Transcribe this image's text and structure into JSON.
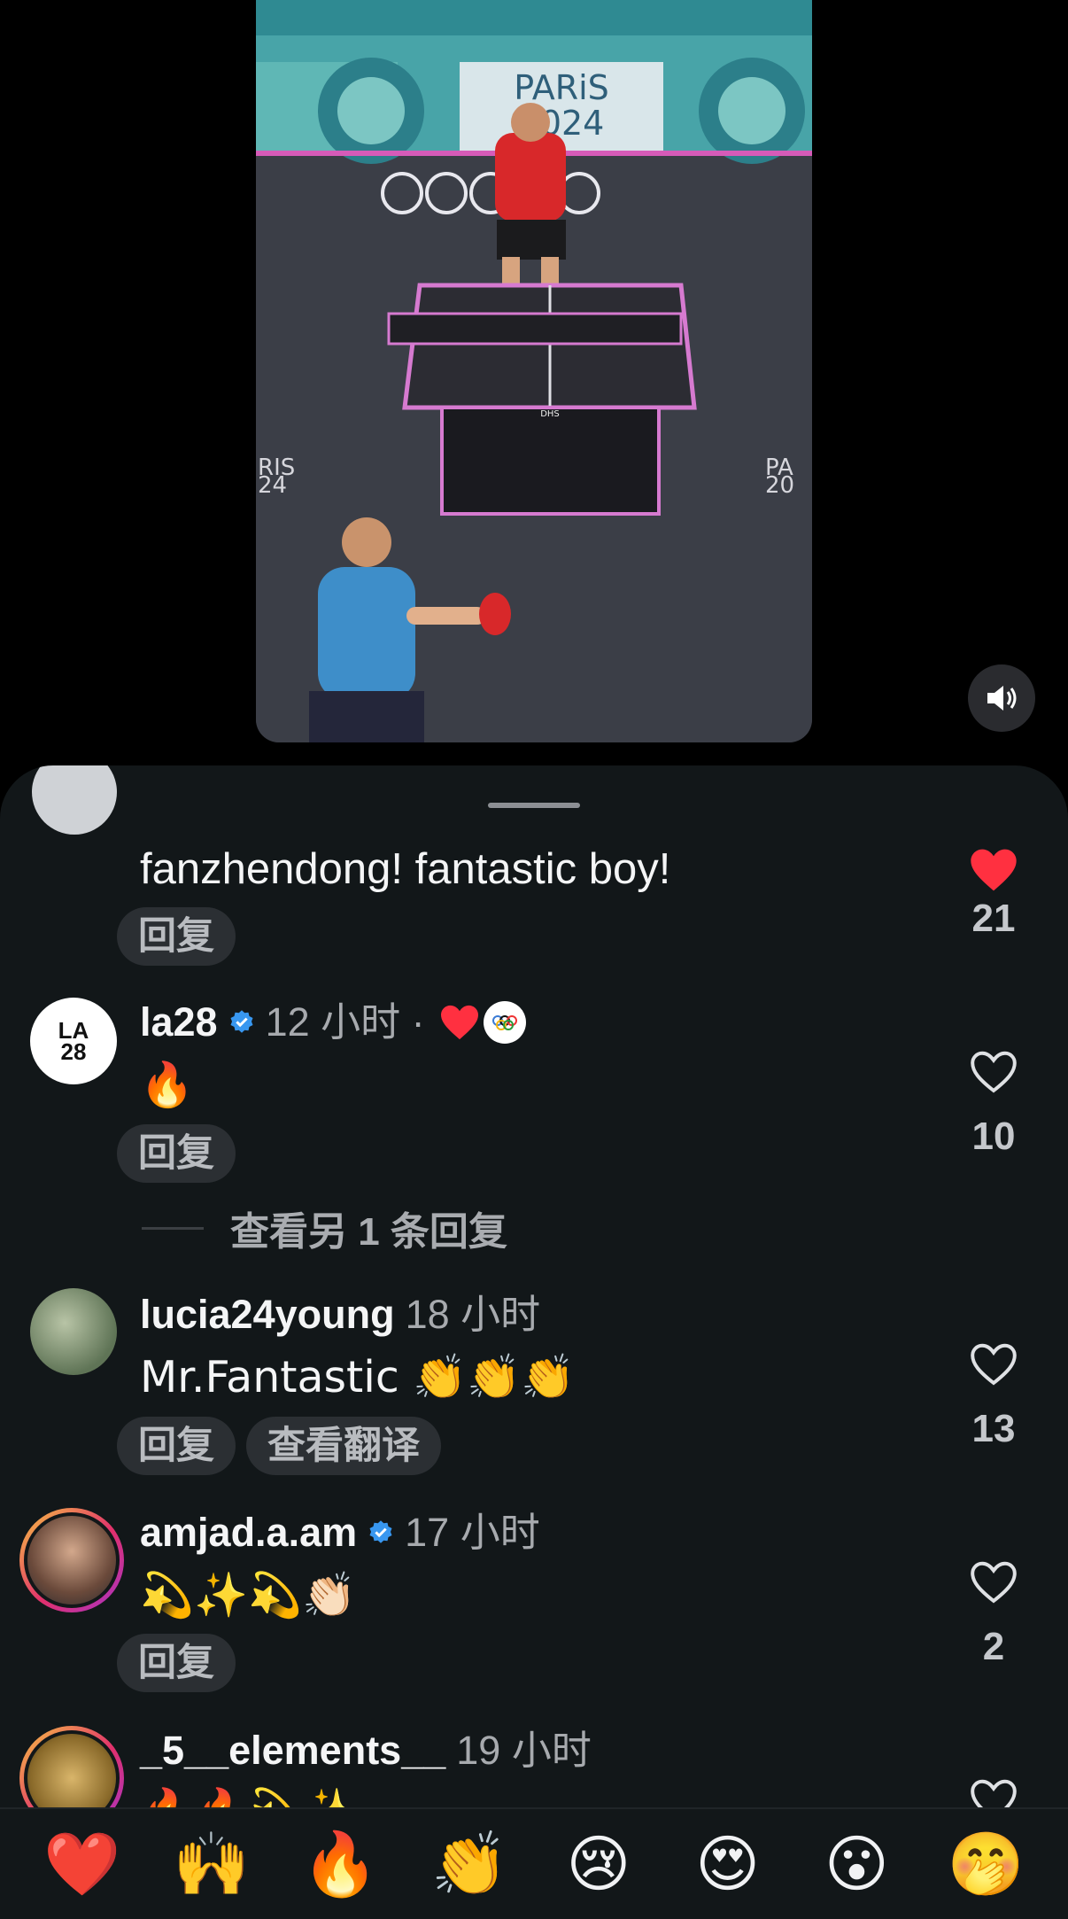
{
  "video": {
    "banner_text_1": "PARiS",
    "banner_text_2": "2024",
    "floor_text_left_1": "RIS",
    "floor_text_left_2": "24",
    "floor_text_right_1": "PA",
    "floor_text_right_2": "20",
    "table_brand": "DHS",
    "volume_icon": "speaker-icon"
  },
  "comments": [
    {
      "username": "",
      "time": "",
      "text": "fanzhendong!   fantastic boy!",
      "reply_label": "回复",
      "liked": true,
      "like_count": "21"
    },
    {
      "username": "la28",
      "verified": true,
      "time": "12 小时 ·",
      "text": "🔥",
      "reply_label": "回复",
      "liked": false,
      "like_count": "10",
      "avatar_text_1": "LA",
      "avatar_text_2": "28",
      "more_replies": "查看另 1 条回复"
    },
    {
      "username": "lucia24young",
      "time": "18 小时",
      "text": "Mr.Fantastic 👏👏👏",
      "reply_label": "回复",
      "translate_label": "查看翻译",
      "liked": false,
      "like_count": "13"
    },
    {
      "username": "amjad.a.am",
      "verified": true,
      "time": "17 小时",
      "text": "💫✨💫👏🏻",
      "reply_label": "回复",
      "liked": false,
      "like_count": "2"
    },
    {
      "username": "_5__elements__",
      "time": "19 小时",
      "text": "🔥🔥💫✨",
      "liked": false,
      "like_count": ""
    }
  ],
  "reactions": [
    "❤️",
    "🙌",
    "🔥",
    "👏",
    "😢",
    "😍",
    "😮",
    "🤭"
  ],
  "colors": {
    "sheet_bg": "#121719",
    "like_red": "#ff3040",
    "verified_blue": "#3897f0"
  }
}
